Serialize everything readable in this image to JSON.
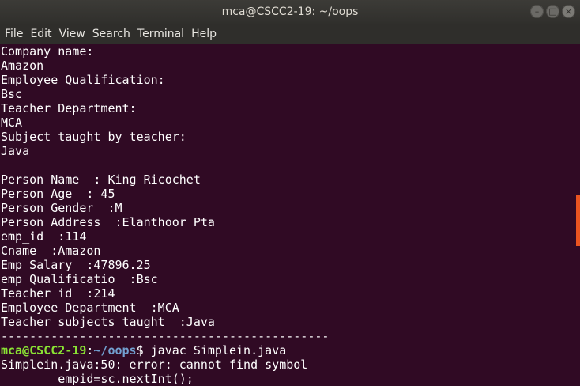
{
  "window": {
    "title": "mca@CSCC2-19: ~/oops",
    "minimize_glyph": "–",
    "maximize_glyph": "□",
    "close_glyph": "×"
  },
  "menubar": {
    "items": [
      "File",
      "Edit",
      "View",
      "Search",
      "Terminal",
      "Help"
    ]
  },
  "terminal": {
    "lines": [
      "Company name:",
      "Amazon",
      "Employee Qualification:",
      "Bsc",
      "Teacher Department:",
      "MCA",
      "Subject taught by teacher:",
      "Java",
      "",
      "Person Name  : King Ricochet",
      "Person Age  : 45",
      "Person Gender  :M",
      "Person Address  :Elanthoor Pta",
      "emp_id  :114",
      "Cname  :Amazon",
      "Emp Salary  :47896.25",
      "emp_Qualificatio  :Bsc",
      "Teacher id  :214",
      "Employee Department  :MCA",
      "Teacher subjects taught  :Java",
      "----------------------------------------------"
    ],
    "prompt": {
      "user_host": "mca@CSCC2-19",
      "separator": ":",
      "path": "~/oops",
      "symbol": "$",
      "command": " javac Simplein.java"
    },
    "output_lines": [
      "Simplein.java:50: error: cannot find symbol",
      "        empid=sc.nextInt();"
    ]
  },
  "colors": {
    "terminal_bg": "#300a24",
    "prompt_user": "#8ae234",
    "prompt_path": "#729fcf",
    "scroll_thumb": "#e95420"
  }
}
